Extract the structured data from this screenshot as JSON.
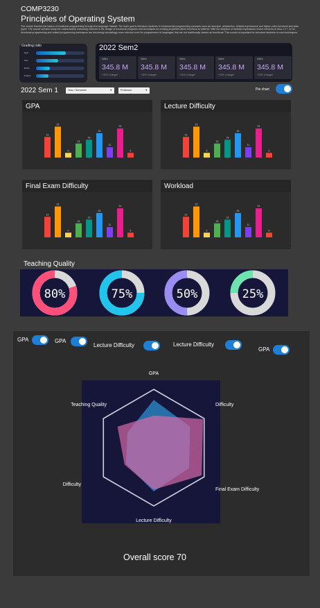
{
  "course": {
    "code": "COMP3230",
    "title": "Principles of Operating System",
    "description": "The course teaches the basics of functional programming through the language Haskell. The main goal is introduce students to fundamental programming concepts such as recursion, abstraction, lambda expressions and higher-order functions and data types. The course will also study the mathematical reasoning involved in the design of functional programs and techniques for proving properties about functions so defined. With the adoption of lambda expressions recent versions of Java, C++ or C#, functional programming and related programming techniques are becoming increasingly more relevant even for programmers of languages that are not traditionally viewed as functional. This course is important for introduce students to such techniques."
  },
  "grading": {
    "title": "Grading ratio",
    "bars": [
      {
        "label": "Quiz",
        "value": 0.62
      },
      {
        "label": "Test",
        "value": 0.45
      },
      {
        "label": "Exam",
        "value": 0.28
      },
      {
        "label": "Project",
        "value": 0.25
      }
    ]
  },
  "sem2": {
    "title": "2022 Sem2",
    "stats": [
      {
        "label": "Sales",
        "value": "345.8 M",
        "sub": "+11% of target"
      },
      {
        "label": "Sales",
        "value": "345.8 M",
        "sub": "+11% of target"
      },
      {
        "label": "Sales",
        "value": "345.8 M",
        "sub": "+11% of target"
      },
      {
        "label": "Sales",
        "value": "345.8 M",
        "sub": "+11% of target"
      },
      {
        "label": "Sales",
        "value": "345.8 M",
        "sub": "+11% of target"
      }
    ]
  },
  "sem1": {
    "title": "2022 Sem 1",
    "dropdown_year": "Year / Semester",
    "dropdown_prof": "Professor",
    "pie_label": "Pie chart"
  },
  "colors": {
    "bars": [
      "#f44336",
      "#ff9800",
      "#ffd54f",
      "#4caf50",
      "#009688",
      "#2196f3",
      "#7e3ff2",
      "#e91e8c",
      "#f44336"
    ]
  },
  "chart_data": [
    {
      "type": "bar",
      "title": "GPA",
      "values": [
        22,
        33,
        5,
        15,
        19,
        26,
        11,
        31,
        5
      ]
    },
    {
      "type": "bar",
      "title": "Lecture Difficulty",
      "values": [
        22,
        33,
        5,
        15,
        19,
        26,
        11,
        31,
        5
      ]
    },
    {
      "type": "bar",
      "title": "Final Exam Difficulty",
      "values": [
        22,
        33,
        5,
        15,
        19,
        26,
        11,
        31,
        5
      ]
    },
    {
      "type": "bar",
      "title": "Workload",
      "values": [
        22,
        33,
        5,
        15,
        19,
        26,
        11,
        31,
        5
      ]
    }
  ],
  "teaching_quality": {
    "title": "Teaching Quality",
    "donuts": [
      {
        "label": "80%",
        "value": 0.8,
        "color": "#ff4f7b"
      },
      {
        "label": "75%",
        "value": 0.75,
        "color": "#21c4ea"
      },
      {
        "label": "50%",
        "value": 0.5,
        "color": "#9a8cf0"
      },
      {
        "label": "25%",
        "value": 0.25,
        "color": "#6de3b0"
      }
    ],
    "track_color": "#d9d9d9"
  },
  "radar": {
    "toggles": [
      "GPA",
      "GPA",
      "Lecture Difficulty",
      "Lecture Difficulty",
      "GPA"
    ],
    "axes": [
      "GPA",
      "Difficulty",
      "Final Exam Difficulty",
      "Lecture Difficulty",
      "Difficulty",
      "Teaching Quality"
    ],
    "series_a": [
      0.82,
      0.72,
      0.7,
      0.75,
      0.55,
      0.52
    ],
    "series_b": [
      0.55,
      0.98,
      0.95,
      0.72,
      0.58,
      0.72
    ],
    "overall": "Overall score 70"
  }
}
